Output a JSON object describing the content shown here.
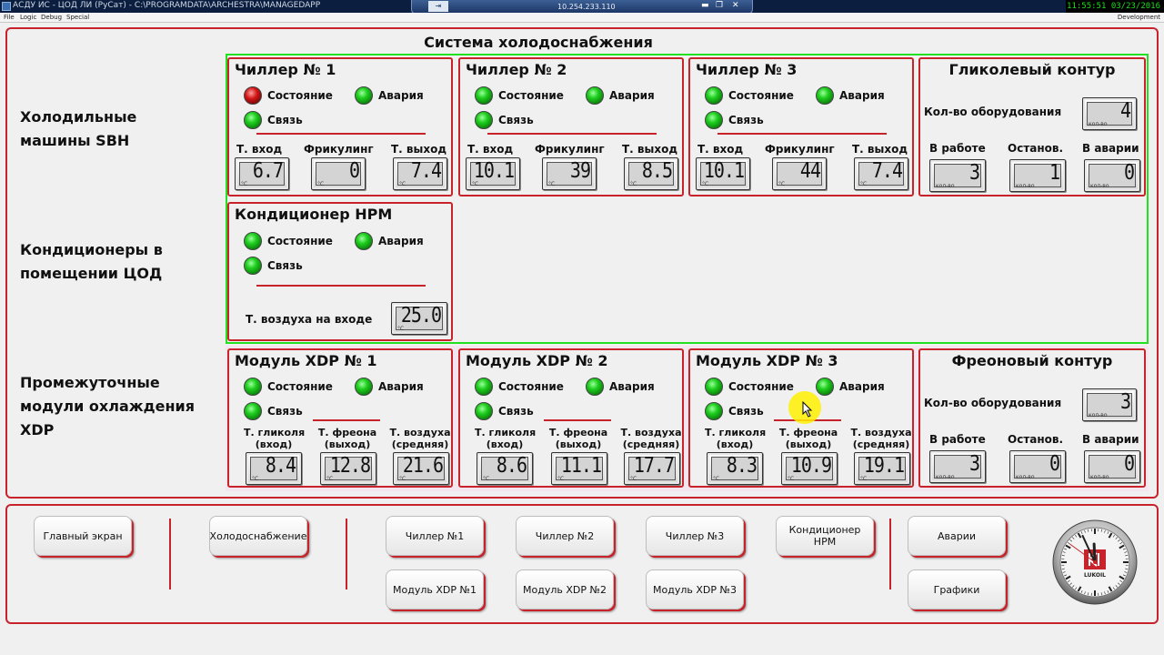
{
  "titlebar": {
    "title": "АСДУ ИС - ЦОД ЛИ (РуСат) - C:\\PROGRAMDATA\\ARCHESTRA\\MANAGEDAPP",
    "rdp_ip": "10.254.233.110",
    "clock_text": "11:55:51  03/23/2016"
  },
  "menu": {
    "items": [
      "File",
      "Logic",
      "Debug",
      "Special"
    ],
    "right_label": "Development"
  },
  "main_title": "Система холодоснабжения",
  "row_labels": {
    "chillers": "Холодильные машины SBH",
    "conditioners": "Кондиционеры в помещении ЦОД",
    "modules": "Промежуточные модули охлаждения XDP"
  },
  "status_labels": {
    "state": "Состояние",
    "alarm": "Авария",
    "link": "Связь"
  },
  "chiller_headers": [
    "Т. вход",
    "Фрикулинг",
    "Т. выход"
  ],
  "chillers": [
    {
      "title": "Чиллер № 1",
      "state_color": "red",
      "alarm_color": "green",
      "link_color": "green",
      "values": [
        "6.7",
        "0",
        "7.4"
      ]
    },
    {
      "title": "Чиллер № 2",
      "state_color": "green",
      "alarm_color": "green",
      "link_color": "green",
      "values": [
        "10.1",
        "39",
        "8.5"
      ]
    },
    {
      "title": "Чиллер № 3",
      "state_color": "green",
      "alarm_color": "green",
      "link_color": "green",
      "values": [
        "10.1",
        "44",
        "7.4"
      ]
    }
  ],
  "glycol": {
    "title": "Гликолевый контур",
    "count_label": "Кол-во оборудования",
    "count": "4",
    "headers": [
      "В работе",
      "Останов.",
      "В аварии"
    ],
    "values": [
      "3",
      "1",
      "0"
    ]
  },
  "conditioner": {
    "title": "Кондиционер НРМ",
    "air_label": "Т. воздуха на входе",
    "air_value": "25.0",
    "state_color": "green",
    "alarm_color": "green",
    "link_color": "green"
  },
  "module_headers": [
    [
      "Т. гликоля",
      "(вход)"
    ],
    [
      "Т. фреона",
      "(выход)"
    ],
    [
      "Т. воздуха",
      "(средняя)"
    ]
  ],
  "modules": [
    {
      "title": "Модуль XDP № 1",
      "values": [
        "8.4",
        "12.8",
        "21.6"
      ],
      "state_color": "green",
      "alarm_color": "green",
      "link_color": "green"
    },
    {
      "title": "Модуль XDP № 2",
      "values": [
        "8.6",
        "11.1",
        "17.7"
      ],
      "state_color": "green",
      "alarm_color": "green",
      "link_color": "green"
    },
    {
      "title": "Модуль XDP № 3",
      "values": [
        "8.3",
        "10.9",
        "19.1"
      ],
      "state_color": "green",
      "alarm_color": "green",
      "link_color": "green"
    }
  ],
  "freon": {
    "title": "Фреоновый контур",
    "count_label": "Кол-во оборудования",
    "count": "3",
    "headers": [
      "В работе",
      "Останов.",
      "В аварии"
    ],
    "values": [
      "3",
      "0",
      "0"
    ]
  },
  "nav": {
    "main_screen": "Главный экран",
    "cooling": "Холодоснабжение",
    "chiller1": "Чиллер №1",
    "chiller2": "Чиллер №2",
    "chiller3": "Чиллер №3",
    "conditioner": "Кондиционер НРМ",
    "alarms": "Аварии",
    "module1": "Модуль XDP №1",
    "module2": "Модуль XDP №2",
    "module3": "Модуль XDP №3",
    "charts": "Графики"
  },
  "clock": {
    "logo_text": "LUKOIL",
    "hour": 11,
    "minute": 55,
    "second": 51
  },
  "colors": {
    "accent_red": "#c8222a",
    "frame_green": "#22e022",
    "led_green": "#1fcf1f",
    "led_red": "#d21414"
  }
}
